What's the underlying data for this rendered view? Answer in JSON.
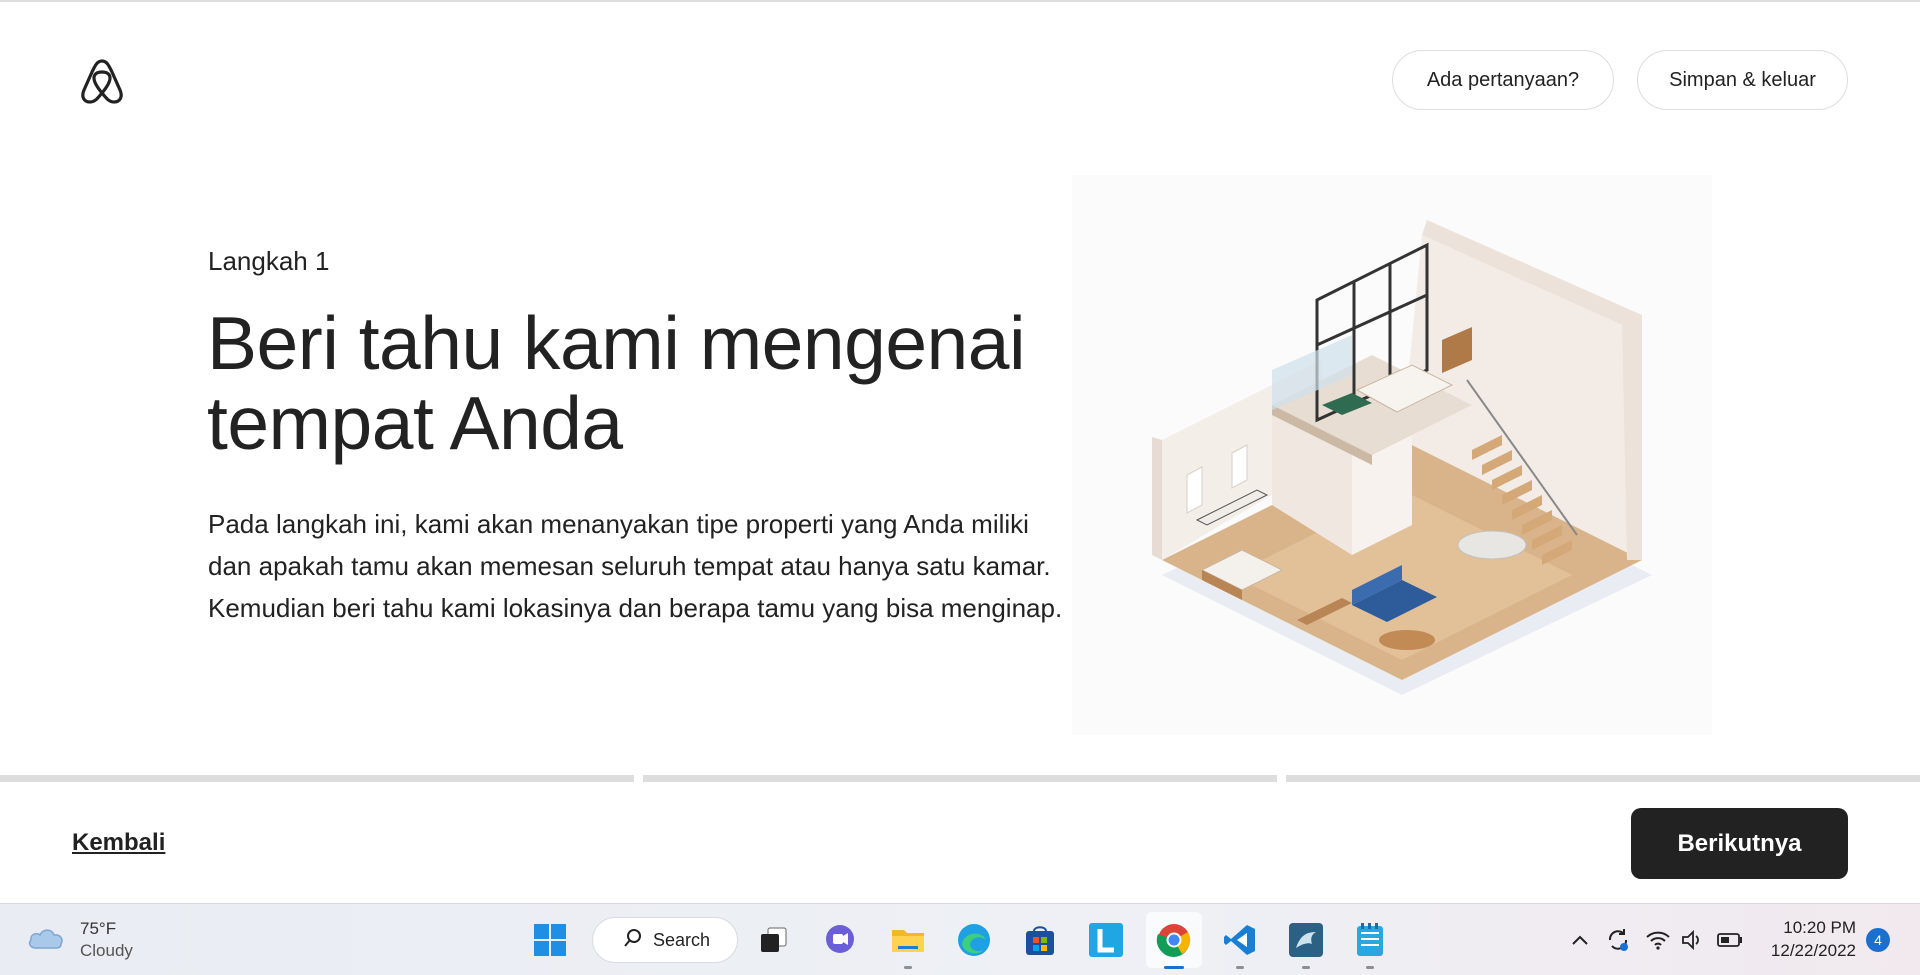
{
  "header": {
    "question_label": "Ada pertanyaan?",
    "save_exit_label": "Simpan & keluar"
  },
  "main": {
    "step": "Langkah 1",
    "title_line1": "Beri tahu kami mengenai",
    "title_line2": "tempat Anda",
    "description": "Pada langkah ini, kami akan menanyakan tipe properti yang Anda miliki dan apakah tamu akan memesan seluruh tempat atau hanya satu kamar. Kemudian beri tahu kami lokasinya dan berapa tamu yang bisa menginap."
  },
  "footer": {
    "back_label": "Kembali",
    "next_label": "Berikutnya"
  },
  "progress": {
    "segments": 3,
    "completed": 0
  },
  "taskbar": {
    "weather_temp": "75°F",
    "weather_condition": "Cloudy",
    "search_label": "Search",
    "apps": [
      "start-icon",
      "search",
      "task-view-icon",
      "teams-chat-icon",
      "file-explorer-icon",
      "edge-icon",
      "store-icon",
      "l-app-icon",
      "chrome-icon",
      "vscode-icon",
      "mysql-workbench-icon",
      "notepad-icon"
    ],
    "time": "10:20 PM",
    "date": "12/22/2022",
    "notifications": "4"
  },
  "colors": {
    "text": "#222222",
    "button_dark": "#222222",
    "border": "#dddddd",
    "accent_blue": "#1a6fd1"
  }
}
